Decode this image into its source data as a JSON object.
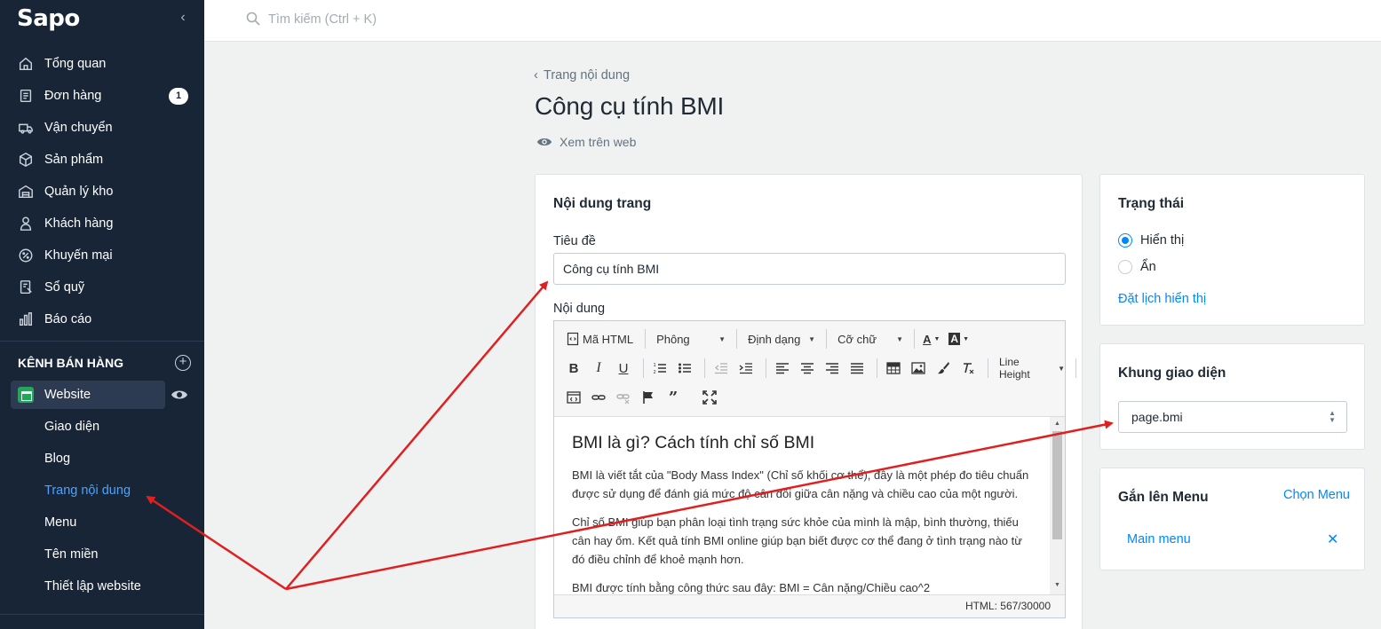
{
  "app": {
    "logo": "Sapo"
  },
  "search": {
    "placeholder": "Tìm kiếm (Ctrl + K)"
  },
  "sidebar": {
    "items": [
      {
        "label": "Tổng quan",
        "icon": "home-icon"
      },
      {
        "label": "Đơn hàng",
        "icon": "order-icon",
        "badge": "1"
      },
      {
        "label": "Vận chuyển",
        "icon": "truck-icon"
      },
      {
        "label": "Sản phẩm",
        "icon": "box-icon"
      },
      {
        "label": "Quản lý kho",
        "icon": "warehouse-icon"
      },
      {
        "label": "Khách hàng",
        "icon": "user-icon"
      },
      {
        "label": "Khuyến mại",
        "icon": "discount-icon"
      },
      {
        "label": "Sổ quỹ",
        "icon": "cashbook-icon"
      },
      {
        "label": "Báo cáo",
        "icon": "chart-icon"
      }
    ],
    "channel_heading": "KÊNH BÁN HÀNG",
    "website": "Website",
    "sub_items": [
      {
        "label": "Giao diện"
      },
      {
        "label": "Blog"
      },
      {
        "label": "Trang nội dung",
        "active": true
      },
      {
        "label": "Menu"
      },
      {
        "label": "Tên miền"
      },
      {
        "label": "Thiết lập website"
      }
    ]
  },
  "page": {
    "back_label": "Trang nội dung",
    "title": "Công cụ tính BMI",
    "view_web": "Xem trên web"
  },
  "content_card": {
    "heading": "Nội dung trang",
    "title_label": "Tiêu đề",
    "title_value": "Công cụ tính BMI",
    "content_label": "Nội dung",
    "toolbar": {
      "html": "Mã HTML",
      "font": "Phông",
      "format": "Định dạng",
      "size": "Cỡ chữ",
      "line_height": "Line Height"
    },
    "body": {
      "heading": "BMI là gì? Cách tính chỉ số BMI",
      "p1": "BMI là viết tắt của \"Body Mass Index\" (Chỉ số khối cơ thể), đây là một phép đo tiêu chuẩn được sử dụng để đánh giá mức độ cân đối giữa cân nặng và chiều cao của một người.",
      "p2": "Chỉ số BMI giúp bạn phân loại tình trạng sức khỏe của mình là mập, bình thường, thiếu cân hay ốm. Kết quả tính BMI online giúp bạn biết được cơ thể đang ở tình trạng nào từ đó điều chỉnh để khoẻ mạnh hơn.",
      "p3": "BMI được tính bằng công thức sau đây: BMI = Cân nặng/Chiều cao^2"
    },
    "status_bar": "HTML: 567/30000"
  },
  "status_card": {
    "heading": "Trạng thái",
    "option_show": "Hiển thị",
    "option_hide": "Ẩn",
    "selected": "Hiển thị",
    "schedule_link": "Đặt lịch hiển thị"
  },
  "theme_card": {
    "heading": "Khung giao diện",
    "selected": "page.bmi"
  },
  "menu_card": {
    "heading": "Gắn lên Menu",
    "choose_link": "Chọn Menu",
    "menu_item": "Main menu"
  },
  "colors": {
    "sidebar_bg": "#182537",
    "accent": "#0088ff",
    "annotation_arrow": "#e02020"
  }
}
